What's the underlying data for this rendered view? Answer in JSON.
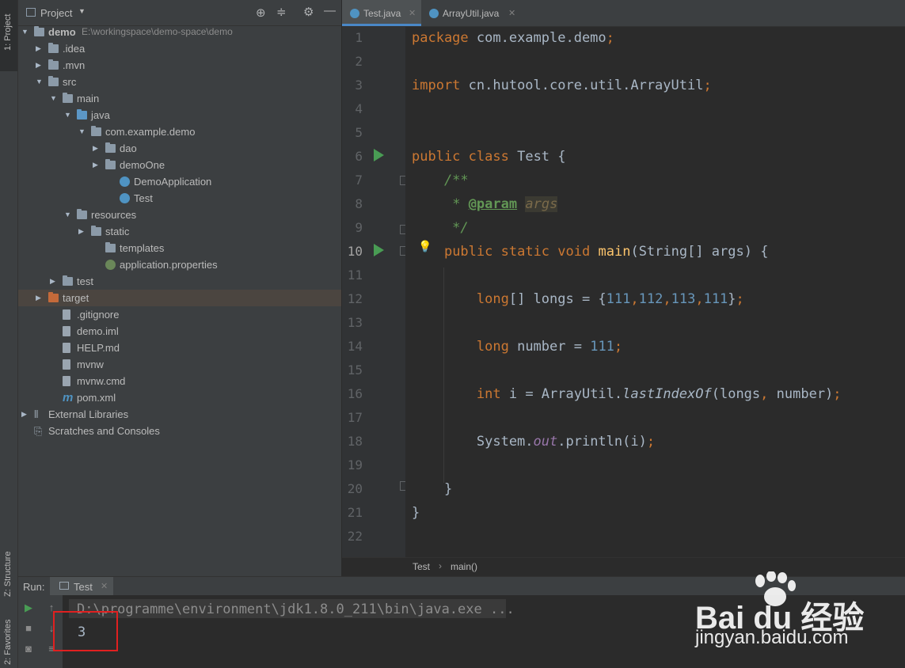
{
  "sidebar_tabs": {
    "project": "1: Project",
    "structure": "Z: Structure",
    "favorites": "2: Favorites"
  },
  "project_panel": {
    "title": "Project",
    "tree": [
      {
        "label": "demo",
        "path": "E:\\workingspace\\demo-space\\demo",
        "indent": 0,
        "arrow": "down",
        "icon": "folder"
      },
      {
        "label": ".idea",
        "indent": 1,
        "arrow": "right",
        "icon": "folder"
      },
      {
        "label": ".mvn",
        "indent": 1,
        "arrow": "right",
        "icon": "folder"
      },
      {
        "label": "src",
        "indent": 1,
        "arrow": "down",
        "icon": "folder"
      },
      {
        "label": "main",
        "indent": 2,
        "arrow": "down",
        "icon": "folder"
      },
      {
        "label": "java",
        "indent": 3,
        "arrow": "down",
        "icon": "folder-blue"
      },
      {
        "label": "com.example.demo",
        "indent": 4,
        "arrow": "down",
        "icon": "package"
      },
      {
        "label": "dao",
        "indent": 5,
        "arrow": "right",
        "icon": "package"
      },
      {
        "label": "demoOne",
        "indent": 5,
        "arrow": "right",
        "icon": "package"
      },
      {
        "label": "DemoApplication",
        "indent": 6,
        "arrow": "",
        "icon": "class"
      },
      {
        "label": "Test",
        "indent": 6,
        "arrow": "",
        "icon": "class"
      },
      {
        "label": "resources",
        "indent": 3,
        "arrow": "down",
        "icon": "folder"
      },
      {
        "label": "static",
        "indent": 4,
        "arrow": "right",
        "icon": "folder"
      },
      {
        "label": "templates",
        "indent": 5,
        "arrow": "",
        "icon": "folder"
      },
      {
        "label": "application.properties",
        "indent": 5,
        "arrow": "",
        "icon": "properties"
      },
      {
        "label": "test",
        "indent": 2,
        "arrow": "right",
        "icon": "folder"
      },
      {
        "label": "target",
        "indent": 1,
        "arrow": "right",
        "icon": "folder-orange",
        "selected": true
      },
      {
        "label": ".gitignore",
        "indent": 2,
        "arrow": "",
        "icon": "file"
      },
      {
        "label": "demo.iml",
        "indent": 2,
        "arrow": "",
        "icon": "file"
      },
      {
        "label": "HELP.md",
        "indent": 2,
        "arrow": "",
        "icon": "file"
      },
      {
        "label": "mvnw",
        "indent": 2,
        "arrow": "",
        "icon": "file"
      },
      {
        "label": "mvnw.cmd",
        "indent": 2,
        "arrow": "",
        "icon": "file"
      },
      {
        "label": "pom.xml",
        "indent": 2,
        "arrow": "",
        "icon": "maven"
      },
      {
        "label": "External Libraries",
        "indent": 0,
        "arrow": "right",
        "icon": "library"
      },
      {
        "label": "Scratches and Consoles",
        "indent": 0,
        "arrow": "",
        "icon": "scratch"
      }
    ]
  },
  "editor_tabs": [
    {
      "label": "Test.java",
      "active": true
    },
    {
      "label": "ArrayUtil.java",
      "active": false
    }
  ],
  "code_lines": [
    "package com.example.demo;",
    "",
    "import cn.hutool.core.util.ArrayUtil;",
    "",
    "",
    "public class Test {",
    "    /**",
    "     * @param args",
    "     */",
    "    public static void main(String[] args) {",
    "",
    "        long[] longs = {111,112,113,111};",
    "",
    "        long number = 111;",
    "",
    "        int i = ArrayUtil.lastIndexOf(longs, number);",
    "",
    "        System.out.println(i);",
    "",
    "    }",
    "}",
    ""
  ],
  "breadcrumb": {
    "class": "Test",
    "method": "main()"
  },
  "run_panel": {
    "label": "Run:",
    "tab": "Test",
    "command": "D:\\programme\\environment\\jdk1.8.0_211\\bin\\java.exe ...",
    "output": "3"
  },
  "watermark": {
    "brand": "Bai du 经验",
    "url": "jingyan.baidu.com"
  },
  "colors": {
    "highlight_box": "#e02020",
    "accent": "#4a88c7",
    "run_green": "#499c54"
  }
}
